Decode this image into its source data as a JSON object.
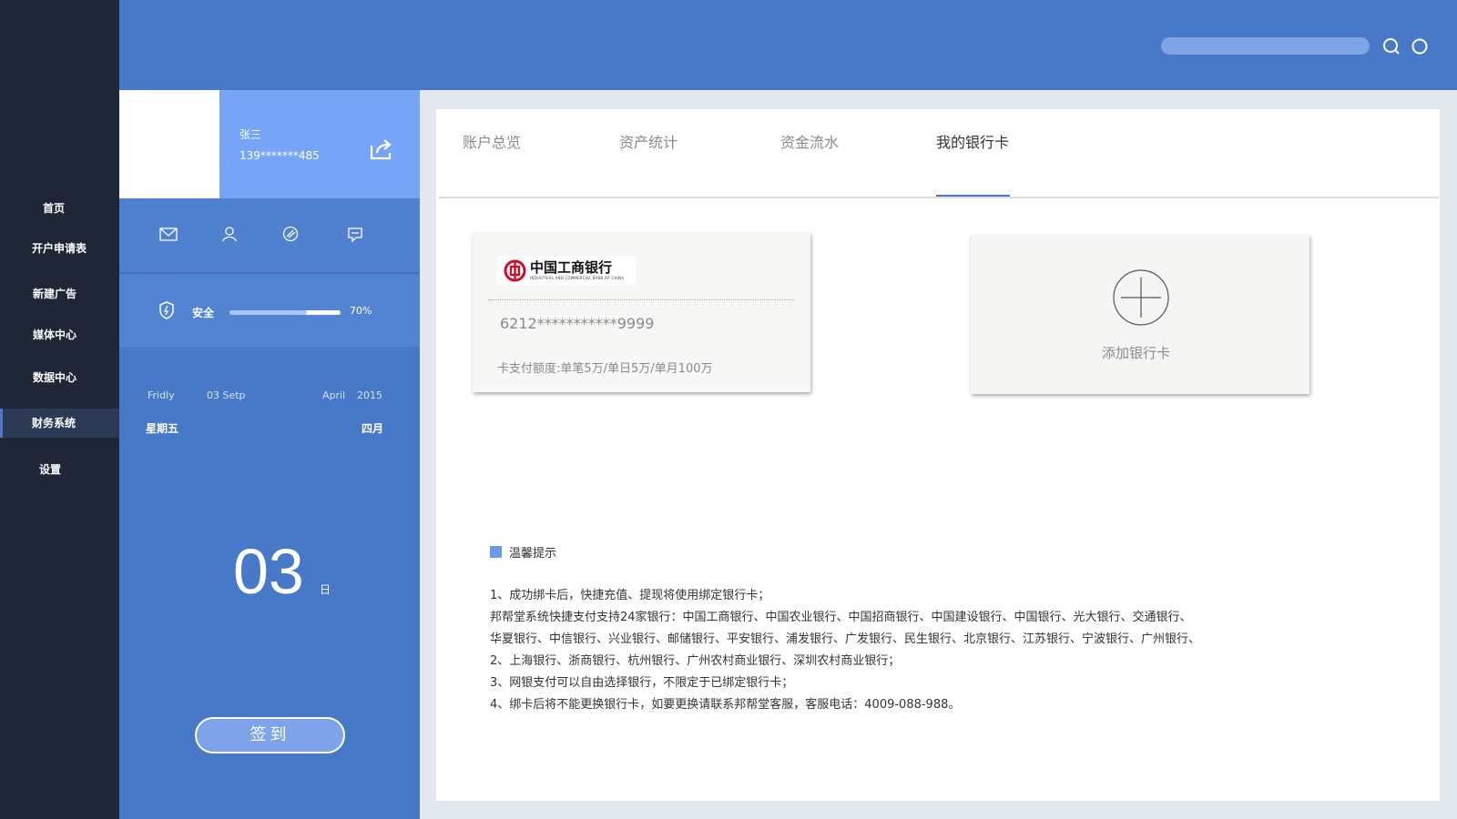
{
  "nav": {
    "items": [
      {
        "label": "首页",
        "active": false
      },
      {
        "label": "开户申请表",
        "active": false
      },
      {
        "label": "新建广告",
        "active": false
      },
      {
        "label": "媒体中心",
        "active": false
      },
      {
        "label": "数据中心",
        "active": false
      },
      {
        "label": "财务系统",
        "active": true
      },
      {
        "label": "设置",
        "active": false
      }
    ]
  },
  "topbar": {
    "search_icon": "search-icon",
    "other_icon": "circle-icon"
  },
  "profile": {
    "name": "张三",
    "phone": "139*******485",
    "share_icon": "share-icon",
    "icons": [
      "mail-icon",
      "user-icon",
      "link-icon",
      "chat-icon"
    ],
    "security_label": "安全",
    "security_percent": 70,
    "security_percent_text": "70%"
  },
  "date": {
    "weekday_en": "Fridly",
    "date_en": "03 Setp",
    "month_en": "April",
    "year": "2015",
    "weekday_cn": "星期五",
    "month_cn": "四月",
    "day": "03",
    "day_unit": "日",
    "checkin_label": "签到"
  },
  "tabs": [
    {
      "label": "账户总览",
      "active": false
    },
    {
      "label": "资产统计",
      "active": false
    },
    {
      "label": "资金流水",
      "active": false
    },
    {
      "label": "我的银行卡",
      "active": true
    }
  ],
  "bank_card": {
    "bank_name": "中国工商银行",
    "bank_name_en": "INDUSTRIAL AND COMMERCIAL BANK OF CHINA",
    "brand_color": "#c8102e",
    "card_number": "6212***********9999",
    "limit": "卡支付额度:单笔5万/单日5万/单月100万"
  },
  "add_card": {
    "label": "添加银行卡"
  },
  "tips": {
    "title": "温馨提示",
    "lines": [
      "1、成功绑卡后，快捷充值、提现将使用绑定银行卡；",
      "邦帮堂系统快捷支付支持24家银行：中国工商银行、中国农业银行、中国招商银行、中国建设银行、中国银行、光大银行、交通银行、",
      "华夏银行、中信银行、兴业银行、邮储银行、平安银行、浦发银行、广发银行、民生银行、北京银行、江苏银行、宁波银行、广州银行、",
      "2、上海银行、浙商银行、杭州银行、广州农村商业银行、深圳农村商业银行；",
      "3、网银支付可以自由选择银行，不限定于已绑定银行卡；",
      "4、绑卡后将不能更换银行卡，如要更换请联系邦帮堂客服，客服电话：4009-088-988。"
    ]
  },
  "colors": {
    "nav_bg": "#1e2638",
    "primary": "#4878c8",
    "user_box": "#76a4f7"
  }
}
